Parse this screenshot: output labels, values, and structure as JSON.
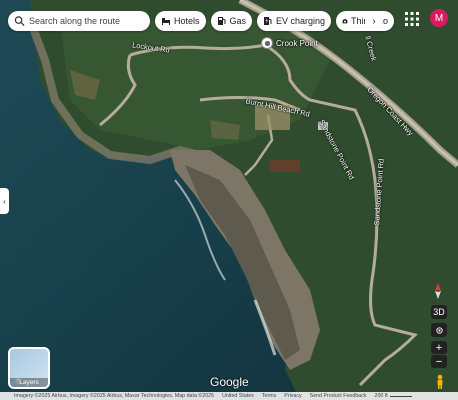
{
  "search": {
    "placeholder": "Search along the route"
  },
  "chips": [
    {
      "label": "Hotels",
      "icon": "bed-icon"
    },
    {
      "label": "Gas",
      "icon": "gas-pump-icon"
    },
    {
      "label": "EV charging",
      "icon": "ev-charging-icon"
    },
    {
      "label": "Things to",
      "icon": "camera-icon"
    }
  ],
  "chips_more_icon": "chevron-right-icon",
  "account": {
    "initial": "M",
    "color": "#d81b60"
  },
  "map_labels": {
    "lockout_rd": "Lockout Rd",
    "burnt_hill_beach_rd": "Burnt Hill Beach Rd",
    "sandstone_point_rd_1": "Sandstone Point Rd",
    "sandstone_point_rd_2": "Sandstone Point Rd",
    "oregon_coast_hwy": "Oregon Coast Hwy",
    "creek": "ll Creek",
    "crook_point": "Crook Point"
  },
  "layers": {
    "label": "Layers"
  },
  "controls": {
    "three_d": "3D",
    "zoom_in": "+",
    "zoom_out": "−"
  },
  "brand": "Google",
  "footer": {
    "imagery": "Imagery ©2025 Airbus, Imagery ©2025 Airbus, Maxar Technologies, Map data ©2025",
    "country": "United States",
    "terms": "Terms",
    "privacy": "Privacy",
    "feedback": "Send Product Feedback",
    "scale": "200 ft"
  }
}
